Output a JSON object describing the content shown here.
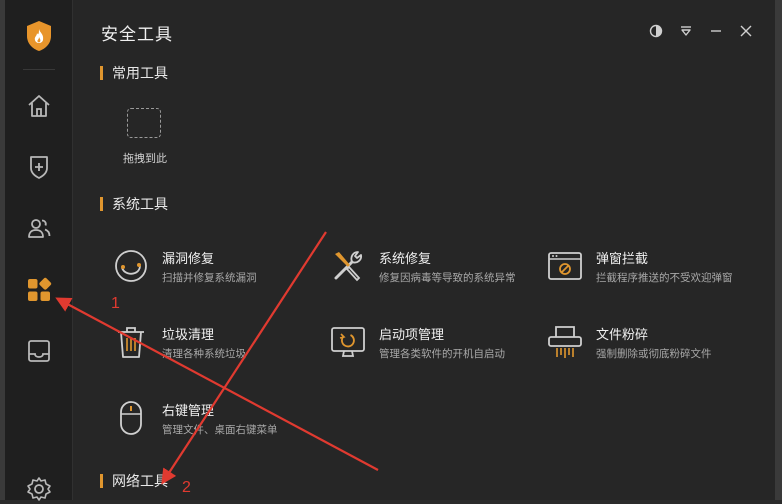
{
  "window": {
    "title": "安全工具",
    "controls": [
      "skin-icon",
      "menu-icon",
      "minimize-icon",
      "close-icon"
    ]
  },
  "sidebar": {
    "logo": "shield-flame-logo",
    "items": [
      {
        "icon": "home-icon",
        "active": false
      },
      {
        "icon": "shield-plus-icon",
        "active": false
      },
      {
        "icon": "users-icon",
        "active": false
      },
      {
        "icon": "apps-grid-icon",
        "active": true
      },
      {
        "icon": "tray-icon",
        "active": false
      },
      {
        "icon": "settings-icon",
        "active": false
      }
    ],
    "active_color": "#e0962e"
  },
  "sections": {
    "common": {
      "title": "常用工具",
      "drop_label": "拖拽到此"
    },
    "system": {
      "title": "系统工具",
      "tools": [
        {
          "name": "漏洞修复",
          "desc": "扫描并修复系统漏洞",
          "icon": "patch-icon"
        },
        {
          "name": "系统修复",
          "desc": "修复因病毒等导致的系统异常",
          "icon": "wrench-screwdriver-icon"
        },
        {
          "name": "弹窗拦截",
          "desc": "拦截程序推送的不受欢迎弹窗",
          "icon": "popup-block-icon"
        },
        {
          "name": "垃圾清理",
          "desc": "清理各种系统垃圾",
          "icon": "trash-icon"
        },
        {
          "name": "启动项管理",
          "desc": "管理各类软件的开机自启动",
          "icon": "monitor-startup-icon"
        },
        {
          "name": "文件粉碎",
          "desc": "强制删除或彻底粉碎文件",
          "icon": "shredder-icon"
        },
        {
          "name": "右键管理",
          "desc": "管理文件、桌面右键菜单",
          "icon": "mouse-icon"
        }
      ]
    },
    "network": {
      "title": "网络工具"
    }
  },
  "annotations": {
    "label_1": "1",
    "label_2": "2",
    "color": "#e03a30"
  },
  "colors": {
    "accent": "#e0962e",
    "background": "#262626",
    "sidebar": "#1f1f1f"
  }
}
